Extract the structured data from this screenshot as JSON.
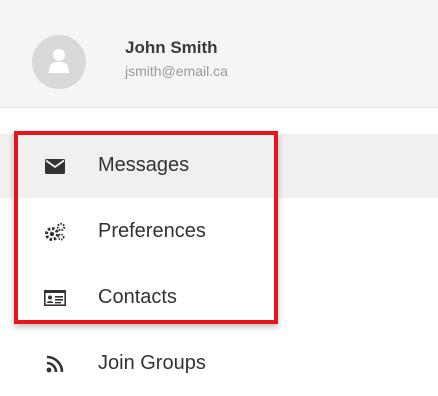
{
  "profile": {
    "name": "John Smith",
    "email": "jsmith@email.ca",
    "avatar_icon": "user-silhouette-icon"
  },
  "menu": {
    "items": [
      {
        "label": "Messages",
        "icon": "envelope-icon",
        "active": true
      },
      {
        "label": "Preferences",
        "icon": "gears-icon",
        "active": false
      },
      {
        "label": "Contacts",
        "icon": "contact-card-icon",
        "active": false
      },
      {
        "label": "Join Groups",
        "icon": "rss-feed-icon",
        "active": false
      }
    ]
  },
  "colors": {
    "highlight": "#e8141b",
    "active_row": "#f0f0f0",
    "header_bg": "#f5f5f5"
  }
}
